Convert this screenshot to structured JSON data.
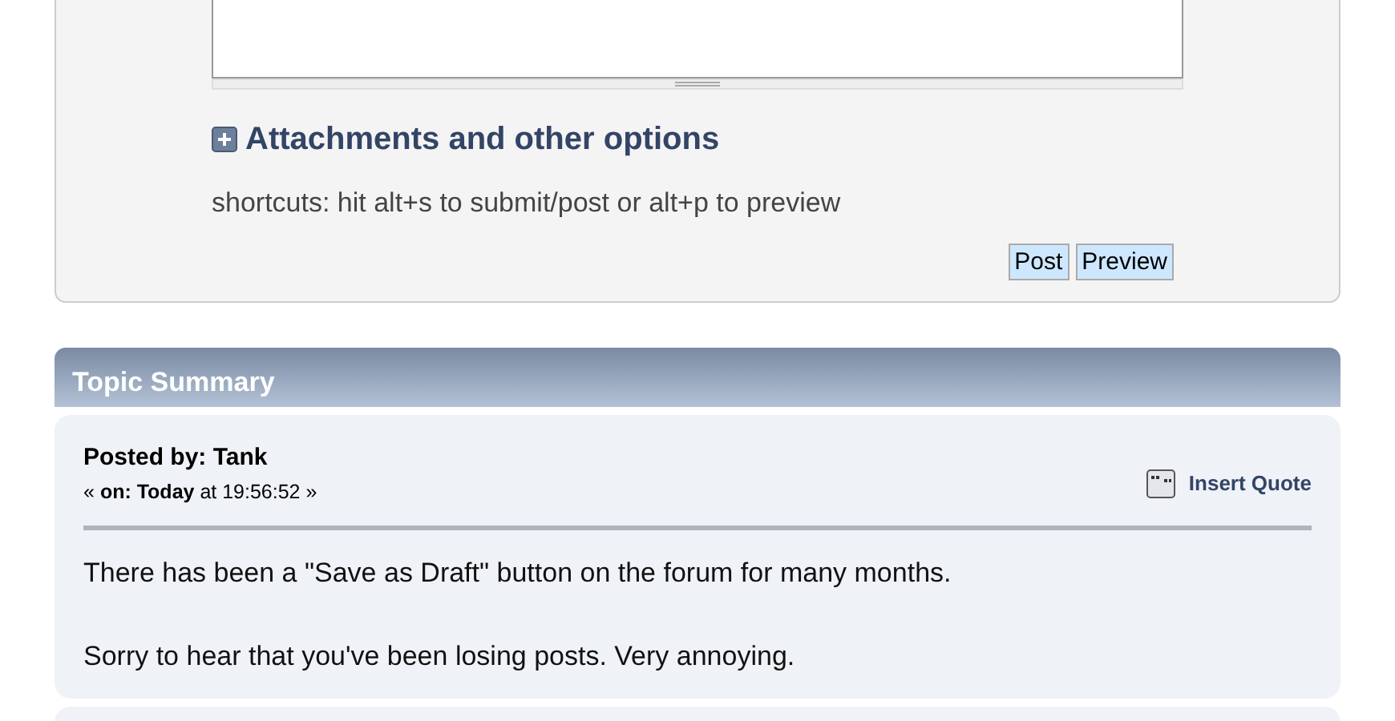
{
  "post_form": {
    "attachments_heading": "Attachments and other options",
    "expanded": false,
    "shortcuts": "shortcuts: hit alt+s to submit/post or alt+p to preview",
    "buttons": [
      "Post",
      "Preview"
    ]
  },
  "topic_summary": {
    "title": "Topic Summary",
    "posts": [
      {
        "posted_by": "Posted by: Tank",
        "date": "« **on: Today** at 19:56:52 »",
        "insert_quote": "Insert Quote",
        "paragraphs": [
          "There has been a \"Save as Draft\" button on the forum for many months.",
          "Sorry to hear that you've been losing posts.  Very annoying."
        ]
      }
    ]
  }
}
